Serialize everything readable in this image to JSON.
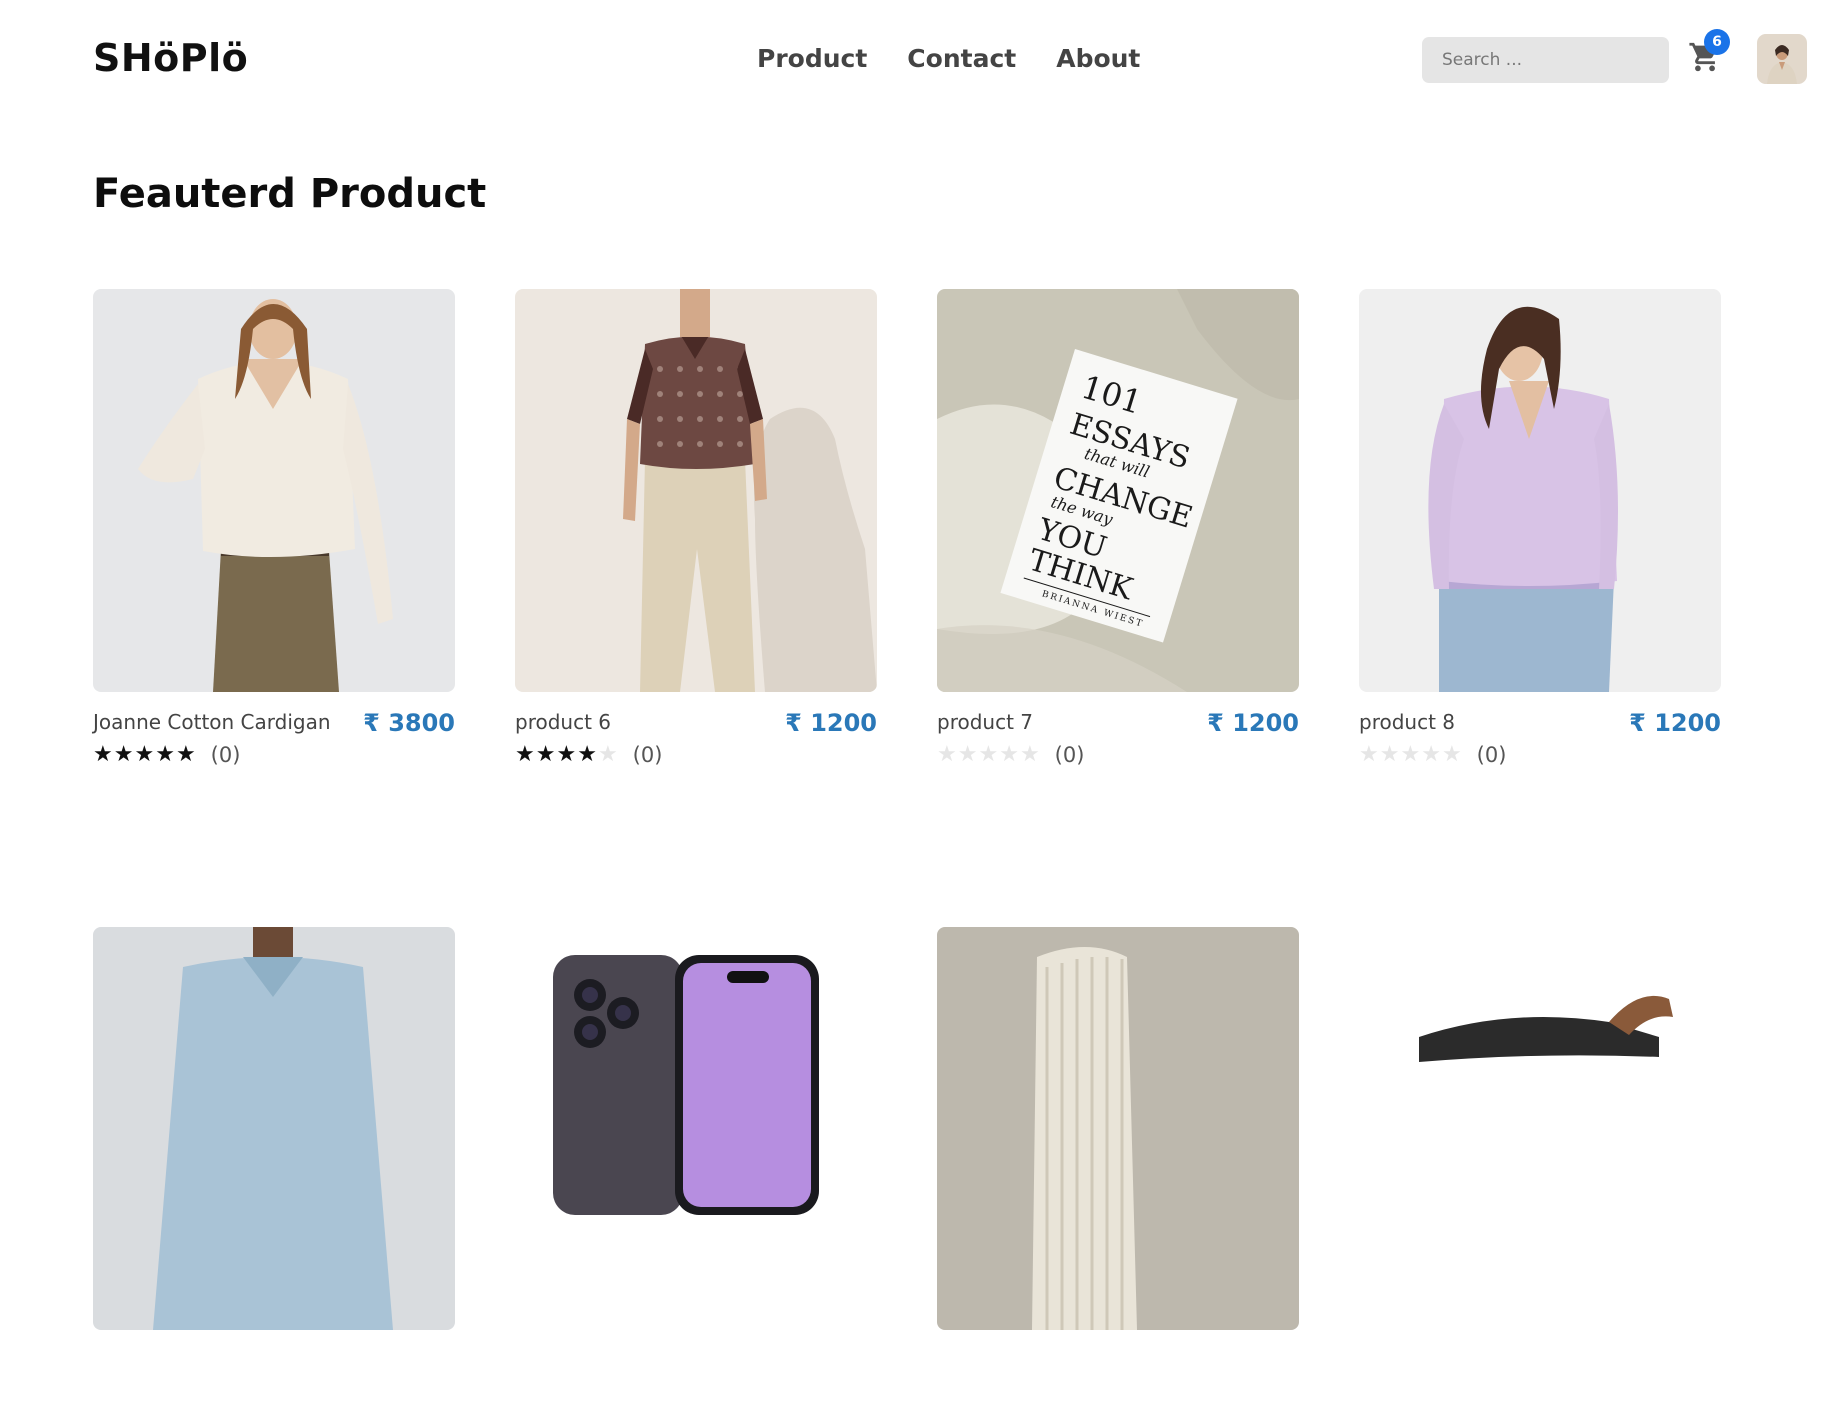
{
  "header": {
    "logo": "SHöPlö",
    "nav": [
      "Product",
      "Contact",
      "About"
    ],
    "search_placeholder": "Search ...",
    "cart_count": "6",
    "icons": {
      "cart": "cart-icon",
      "avatar": "user-avatar"
    }
  },
  "main": {
    "section_title": "Feauterd Product",
    "currency_symbol": "₹",
    "products": [
      {
        "name": "Joanne Cotton Cardigan",
        "price": "3800",
        "rating": 5,
        "count": "(0)"
      },
      {
        "name": "product 6",
        "price": "1200",
        "rating": 4,
        "count": "(0)"
      },
      {
        "name": "product 7",
        "price": "1200",
        "rating": 0,
        "count": "(0)"
      },
      {
        "name": "product 8",
        "price": "1200",
        "rating": 0,
        "count": "(0)"
      },
      {
        "name": "",
        "price": "",
        "rating": 0,
        "count": ""
      },
      {
        "name": "",
        "price": "",
        "rating": 0,
        "count": ""
      },
      {
        "name": "",
        "price": "",
        "rating": 0,
        "count": ""
      },
      {
        "name": "",
        "price": "",
        "rating": 0,
        "count": ""
      }
    ],
    "book_cover": {
      "line1": "101",
      "line2": "ESSAYS",
      "line3": "that will",
      "line4": "CHANGE",
      "line5": "the way",
      "line6": "YOU",
      "line7": "THINK",
      "author": "BRIANNA WIEST"
    }
  },
  "colors": {
    "price": "#2a78b8",
    "badge": "#1a73e8",
    "search_bg": "#e5e5e5"
  }
}
